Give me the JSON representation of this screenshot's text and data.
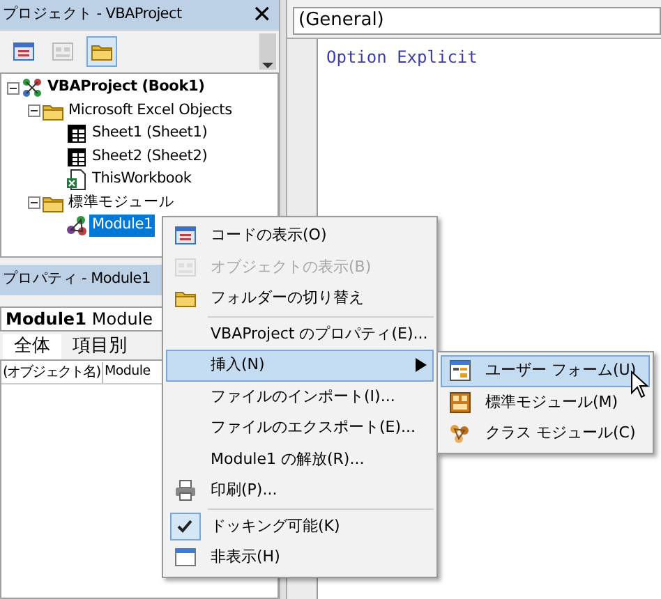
{
  "project_pane": {
    "title": "プロジェクト - VBAProject",
    "close": "✕",
    "toolbar": [
      {
        "kind": "code",
        "selected": false
      },
      {
        "kind": "object",
        "selected": false
      },
      {
        "kind": "folder",
        "selected": true
      }
    ],
    "tree": [
      {
        "label": "VBAProject (Book1)",
        "kind": "project",
        "expanded": true,
        "selected": false,
        "children": [
          {
            "label": "Microsoft Excel Objects",
            "kind": "folder",
            "expanded": true,
            "selected": false,
            "children": [
              {
                "label": "Sheet1 (Sheet1)",
                "kind": "sheet",
                "selected": false
              },
              {
                "label": "Sheet2 (Sheet2)",
                "kind": "sheet",
                "selected": false
              },
              {
                "label": "ThisWorkbook",
                "kind": "workbook",
                "selected": false
              }
            ]
          },
          {
            "label": "標準モジュール",
            "kind": "folder",
            "expanded": true,
            "selected": false,
            "children": [
              {
                "label": "Module1",
                "kind": "module",
                "selected": true
              }
            ]
          }
        ]
      }
    ]
  },
  "properties_pane": {
    "title": "プロパティ - Module1",
    "object_name": "Module1",
    "object_type": "Module",
    "tabs": [
      {
        "label": "全体",
        "selected": true
      },
      {
        "label": "項目別",
        "selected": false
      }
    ],
    "rows": [
      {
        "name": "(オブジェクト名)",
        "value": "Module"
      }
    ]
  },
  "code_pane": {
    "object_combo": "(General)",
    "code": "Option Explicit"
  },
  "context_menu": [
    {
      "label": "コードの表示(O)",
      "kind": "code",
      "disabled": false,
      "selected": false
    },
    {
      "label": "オブジェクトの表示(B)",
      "kind": "object",
      "disabled": true,
      "selected": false
    },
    {
      "label": "フォルダーの切り替え",
      "kind": "folder",
      "disabled": false,
      "selected": false
    },
    {
      "label": "VBAProject のプロパティ(E)...",
      "separator_before": true,
      "disabled": false,
      "selected": false
    },
    {
      "label": "挿入(N)",
      "submenu": true,
      "disabled": false,
      "selected": true
    },
    {
      "label": "ファイルのインポート(I)...",
      "disabled": false,
      "selected": false
    },
    {
      "label": "ファイルのエクスポート(E)...",
      "disabled": false,
      "selected": false
    },
    {
      "label": "Module1 の解放(R)...",
      "disabled": false,
      "selected": false
    },
    {
      "label": "印刷(P)...",
      "kind": "print",
      "disabled": false,
      "selected": false
    },
    {
      "label": "ドッキング可能(K)",
      "kind": "check",
      "checked": true,
      "separator_before": true,
      "disabled": false,
      "selected": false
    },
    {
      "label": "非表示(H)",
      "kind": "window",
      "disabled": false,
      "selected": false
    }
  ],
  "submenu": [
    {
      "label": "ユーザー フォーム(U)",
      "kind": "form",
      "selected": true
    },
    {
      "label": "標準モジュール(M)",
      "kind": "module",
      "selected": false
    },
    {
      "label": "クラス モジュール(C)",
      "kind": "class",
      "selected": false
    }
  ]
}
